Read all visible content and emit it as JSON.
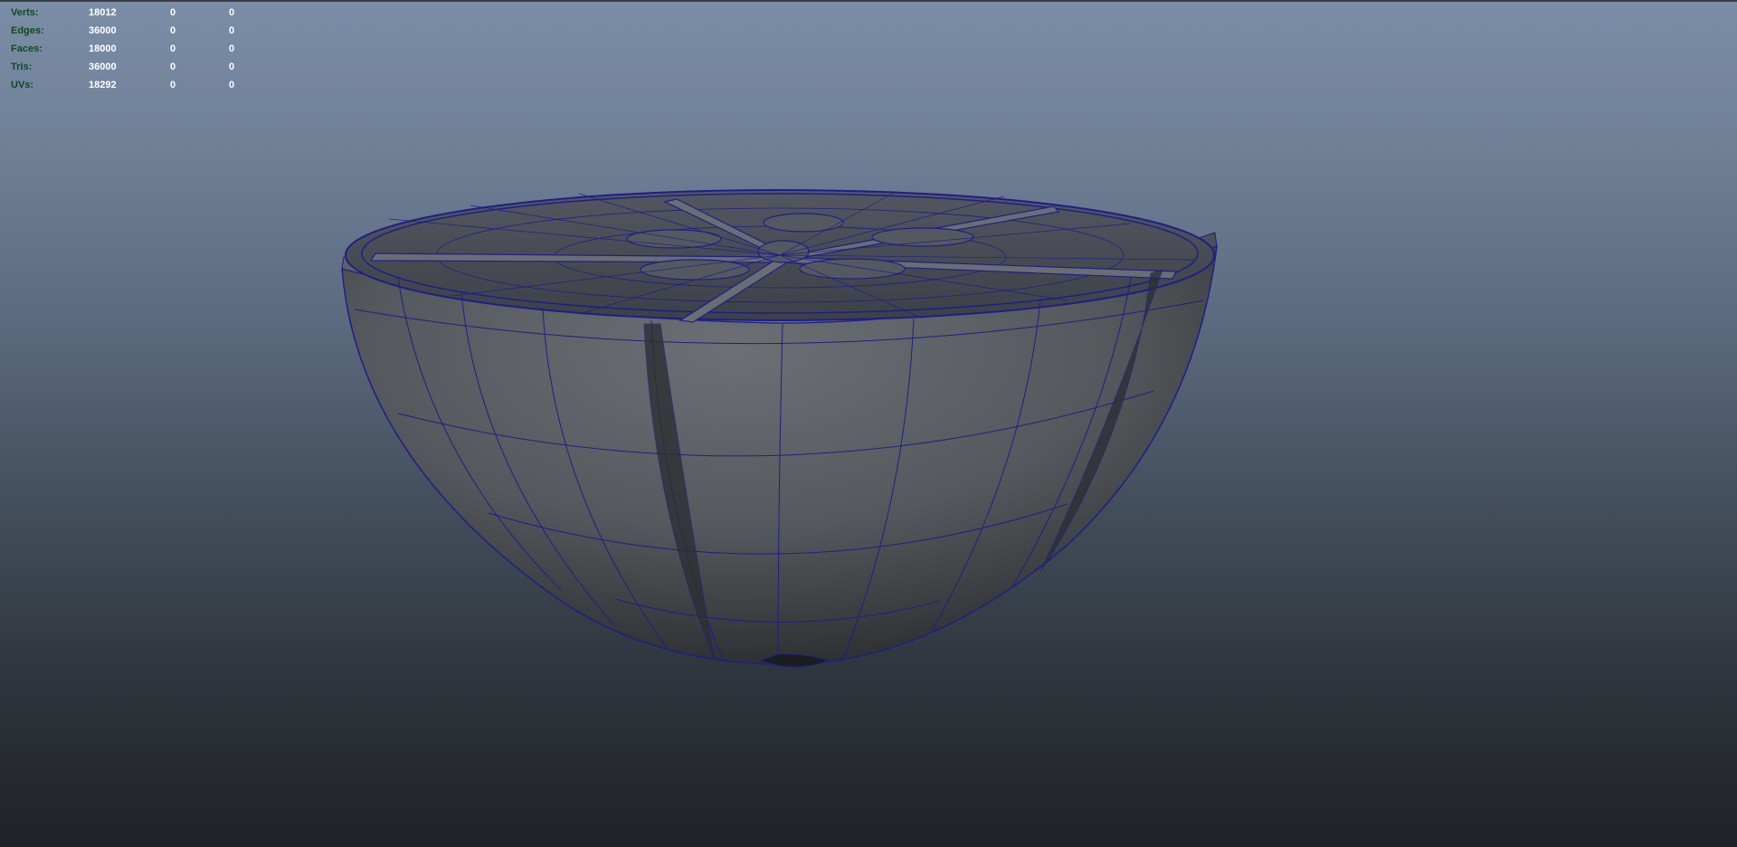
{
  "hud": {
    "rows": [
      {
        "label": "Verts:",
        "values": [
          "18012",
          "0",
          "0"
        ]
      },
      {
        "label": "Edges:",
        "values": [
          "36000",
          "0",
          "0"
        ]
      },
      {
        "label": "Faces:",
        "values": [
          "18000",
          "0",
          "0"
        ]
      },
      {
        "label": "Tris:",
        "values": [
          "36000",
          "0",
          "0"
        ]
      },
      {
        "label": "UVs:",
        "values": [
          "18292",
          "0",
          "0"
        ]
      }
    ]
  },
  "colors": {
    "wireframe": "#1d1f8a",
    "hud_label": "#0d4a22",
    "hud_value": "#ffffff",
    "mesh_shade": "#5a5d62"
  },
  "model": {
    "icon": "half-orange-mesh"
  }
}
